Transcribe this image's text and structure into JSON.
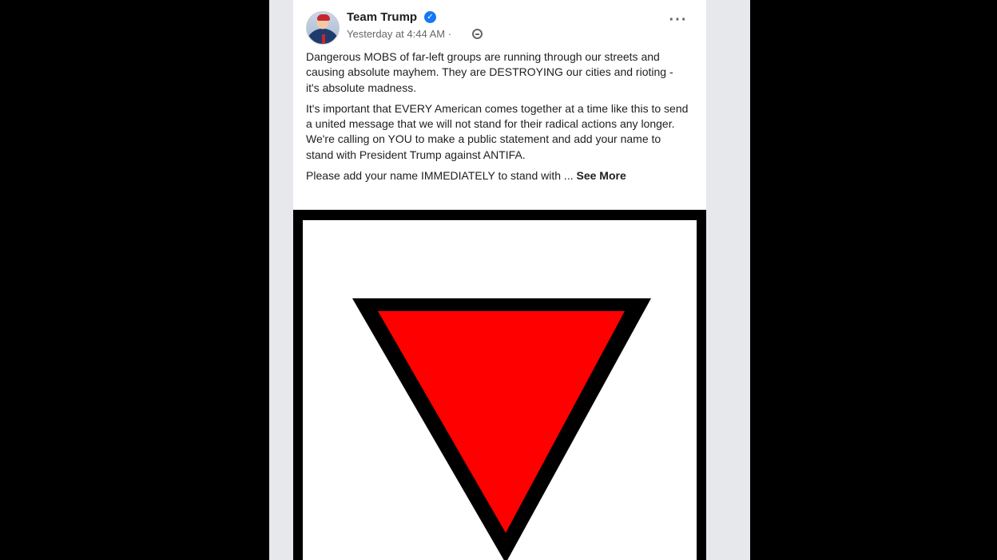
{
  "post": {
    "author": "Team Trump",
    "verified_icon": "verified-badge-icon",
    "timestamp": "Yesterday at 4:44 AM",
    "privacy_separator": "·",
    "privacy_icon": "globe-icon",
    "more_icon": "more-options-icon",
    "paragraphs": [
      "Dangerous MOBS of far-left groups are running through our streets and causing absolute mayhem. They are DESTROYING our cities and rioting - it's absolute madness.",
      "It's important that EVERY American comes together at a time like this to send a united message that we will not stand for their radical actions any longer. We're calling on YOU to make a public statement and add your name to stand with President Trump against ANTIFA."
    ],
    "truncated_line": "Please add your name IMMEDIATELY to stand with ...",
    "see_more": "See More"
  },
  "image": {
    "description_icon": "red-inverted-triangle-graphic",
    "colors": {
      "fill": "#ff0000",
      "outline": "#000000",
      "background": "#ffffff",
      "frame": "#000000"
    }
  },
  "colors": {
    "page_background": "#000000",
    "feed_background": "#e6e8ec",
    "card": "#ffffff",
    "text": "#1c1e21",
    "secondary_text": "#65676b",
    "verified": "#1877f2"
  }
}
